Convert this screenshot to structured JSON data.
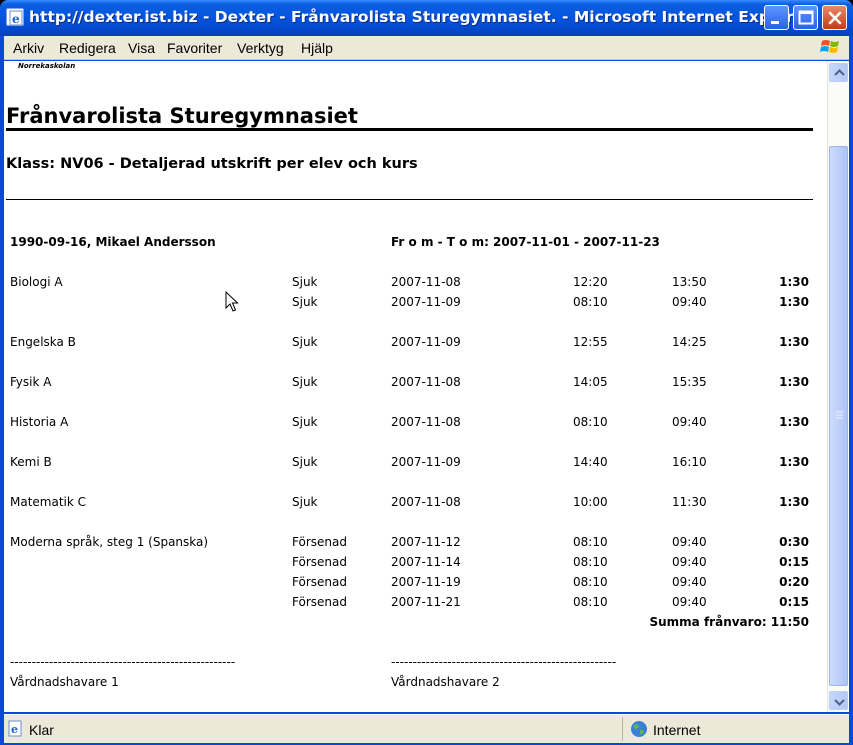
{
  "window": {
    "title": "http://dexter.ist.biz - Dexter - Frånvarolista Sturegymnasiet. - Microsoft Internet Explorer"
  },
  "menu": {
    "items": [
      "Arkiv",
      "Redigera",
      "Visa",
      "Favoriter",
      "Verktyg",
      "Hjälp"
    ]
  },
  "page": {
    "school_logo_text": "Norrekaskolan",
    "title": "Frånvarolista Sturegymnasiet",
    "subtitle": "Klass: NV06 - Detaljerad utskrift per elev och kurs",
    "student": "1990-09-16, Mikael Andersson",
    "period": "Fr o m - T o m: 2007-11-01 - 2007-11-23",
    "courses": [
      {
        "name": "Biologi A",
        "rows": [
          {
            "type": "Sjuk",
            "date": "2007-11-08",
            "from": "12:20",
            "to": "13:50",
            "dur": "1:30"
          },
          {
            "type": "Sjuk",
            "date": "2007-11-09",
            "from": "08:10",
            "to": "09:40",
            "dur": "1:30"
          }
        ]
      },
      {
        "name": "Engelska B",
        "rows": [
          {
            "type": "Sjuk",
            "date": "2007-11-09",
            "from": "12:55",
            "to": "14:25",
            "dur": "1:30"
          }
        ]
      },
      {
        "name": "Fysik A",
        "rows": [
          {
            "type": "Sjuk",
            "date": "2007-11-08",
            "from": "14:05",
            "to": "15:35",
            "dur": "1:30"
          }
        ]
      },
      {
        "name": "Historia A",
        "rows": [
          {
            "type": "Sjuk",
            "date": "2007-11-08",
            "from": "08:10",
            "to": "09:40",
            "dur": "1:30"
          }
        ]
      },
      {
        "name": "Kemi B",
        "rows": [
          {
            "type": "Sjuk",
            "date": "2007-11-09",
            "from": "14:40",
            "to": "16:10",
            "dur": "1:30"
          }
        ]
      },
      {
        "name": "Matematik C",
        "rows": [
          {
            "type": "Sjuk",
            "date": "2007-11-08",
            "from": "10:00",
            "to": "11:30",
            "dur": "1:30"
          }
        ]
      },
      {
        "name": "Moderna språk, steg 1 (Spanska)",
        "rows": [
          {
            "type": "Försenad",
            "date": "2007-11-12",
            "from": "08:10",
            "to": "09:40",
            "dur": "0:30"
          },
          {
            "type": "Försenad",
            "date": "2007-11-14",
            "from": "08:10",
            "to": "09:40",
            "dur": "0:15"
          },
          {
            "type": "Försenad",
            "date": "2007-11-19",
            "from": "08:10",
            "to": "09:40",
            "dur": "0:20"
          },
          {
            "type": "Försenad",
            "date": "2007-11-21",
            "from": "08:10",
            "to": "09:40",
            "dur": "0:15"
          }
        ]
      }
    ],
    "total": "Summa frånvaro: 11:50",
    "signature_line_1": "----------------------------------------------------",
    "signature_line_2": "----------------------------------------------------",
    "guardian_1": "Vårdnadshavare 1",
    "guardian_2": "Vårdnadshavare 2"
  },
  "status": {
    "text": "Klar",
    "zone": "Internet"
  }
}
